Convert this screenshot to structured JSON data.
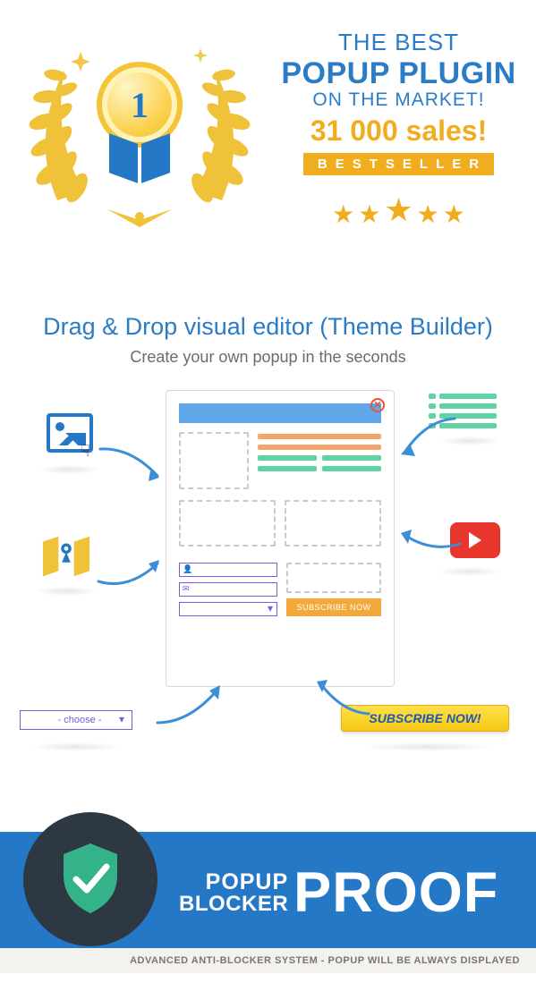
{
  "hero": {
    "medal_number": "1",
    "line1": "THE BEST",
    "line2": "POPUP PLUGIN",
    "line3": "ON THE MARKET!",
    "line4": "31 000 sales!",
    "bestseller": "BESTSELLER"
  },
  "section2": {
    "title": "Drag & Drop visual editor (Theme Builder)",
    "subtitle": "Create your own popup in the seconds"
  },
  "builder": {
    "subscribe_canvas": "SUBSCRIBE NOW",
    "choose_label": "- choose -",
    "subscribe_button": "SUBSCRIBE NOW!"
  },
  "banner": {
    "line1": "POPUP",
    "line2": "BLOCKER",
    "line3": "PROOF"
  },
  "advanced": "ADVANCED ANTI-BLOCKER SYSTEM - POPUP WILL BE ALWAYS DISPLAYED"
}
